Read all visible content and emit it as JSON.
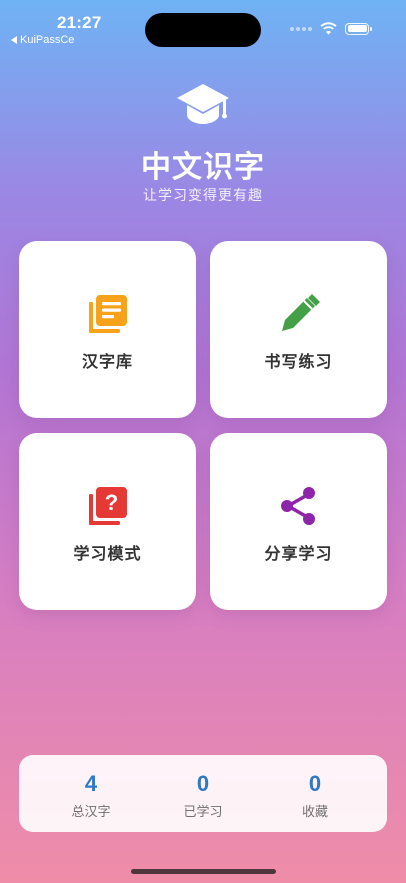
{
  "status_bar": {
    "time": "21:27",
    "back_app": "KuiPassCe"
  },
  "header": {
    "icon": "graduation-cap-icon",
    "title": "中文识字",
    "subtitle": "让学习变得更有趣"
  },
  "cards": [
    {
      "label": "汉字库",
      "icon": "book-stack-icon",
      "color": "#f7a21a"
    },
    {
      "label": "书写练习",
      "icon": "pencil-icon",
      "color": "#43a047"
    },
    {
      "label": "学习模式",
      "icon": "quiz-icon",
      "color": "#e53935"
    },
    {
      "label": "分享学习",
      "icon": "share-icon",
      "color": "#8e24aa"
    }
  ],
  "stats": [
    {
      "value": "4",
      "label": "总汉字"
    },
    {
      "value": "0",
      "label": "已学习"
    },
    {
      "value": "0",
      "label": "收藏"
    }
  ],
  "colors": {
    "stat_value": "#2f78c4",
    "gradient_top": "#6fb3f4",
    "gradient_bottom": "#ef8da8"
  }
}
